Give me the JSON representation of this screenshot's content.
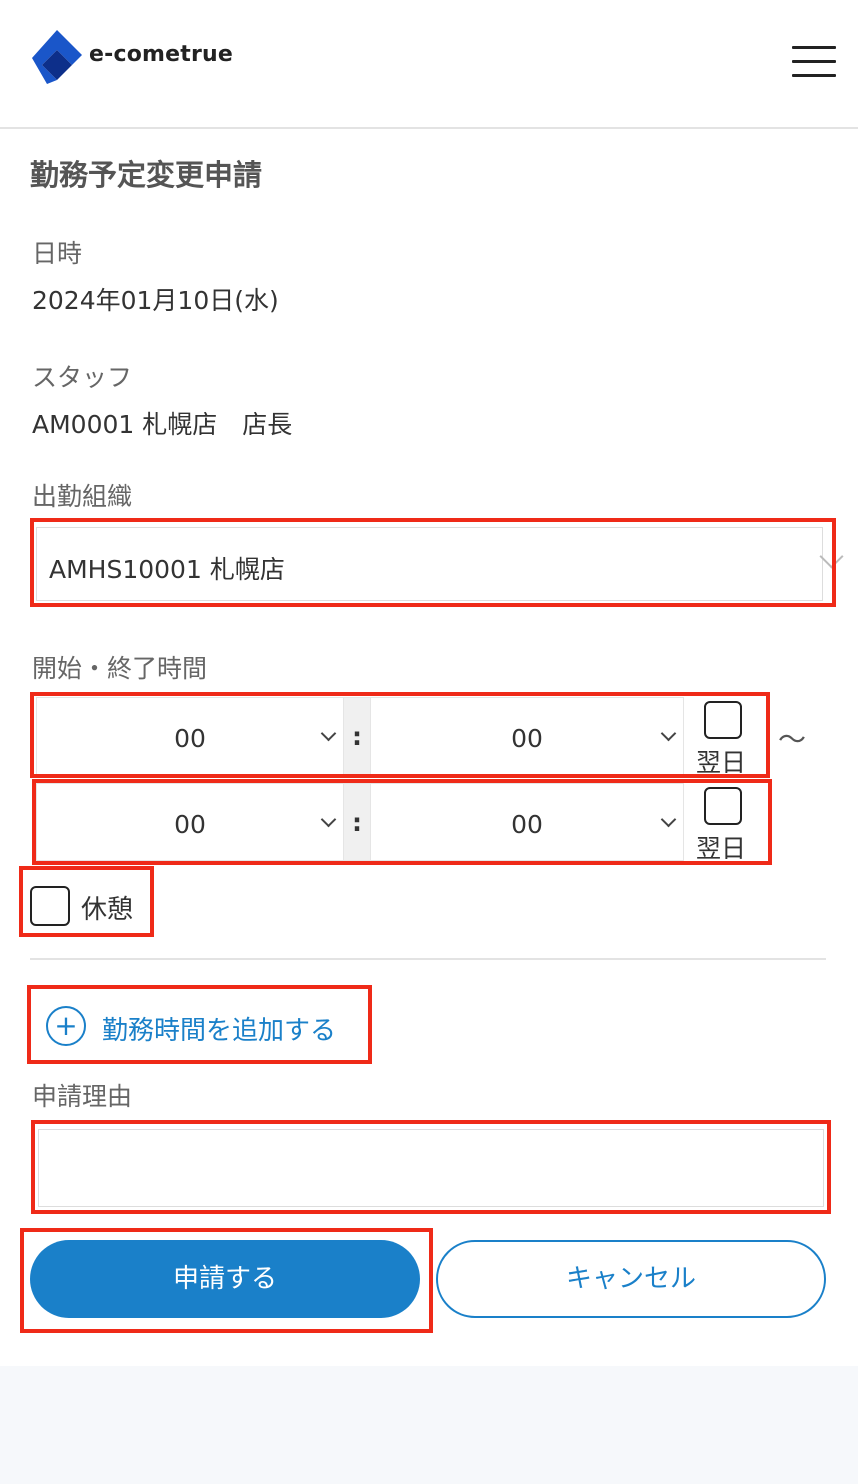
{
  "header": {
    "logo_text": "e-cometrue",
    "brand_color": "#1a56c9"
  },
  "title": "勤務予定変更申請",
  "date": {
    "label": "日時",
    "value": "2024年01月10日(水)"
  },
  "staff": {
    "label": "スタッフ",
    "value": "AM0001 札幌店　店長"
  },
  "org": {
    "label": "出勤組織",
    "selected": "AMHS10001 札幌店"
  },
  "time": {
    "label": "開始・終了時間",
    "separator": ":",
    "range_symbol": "〜",
    "next_day_label": "翌日",
    "start": {
      "hour": "00",
      "minute": "00",
      "next_day": false
    },
    "end": {
      "hour": "00",
      "minute": "00",
      "next_day": false
    }
  },
  "break": {
    "label": "休憩",
    "checked": false
  },
  "add_work_time": {
    "icon": "plus-circle-icon",
    "label": "勤務時間を追加する"
  },
  "reason": {
    "label": "申請理由",
    "value": ""
  },
  "actions": {
    "submit": "申請する",
    "cancel": "キャンセル"
  },
  "colors": {
    "accent": "#1a80c9",
    "highlight": "#ef2a18"
  }
}
